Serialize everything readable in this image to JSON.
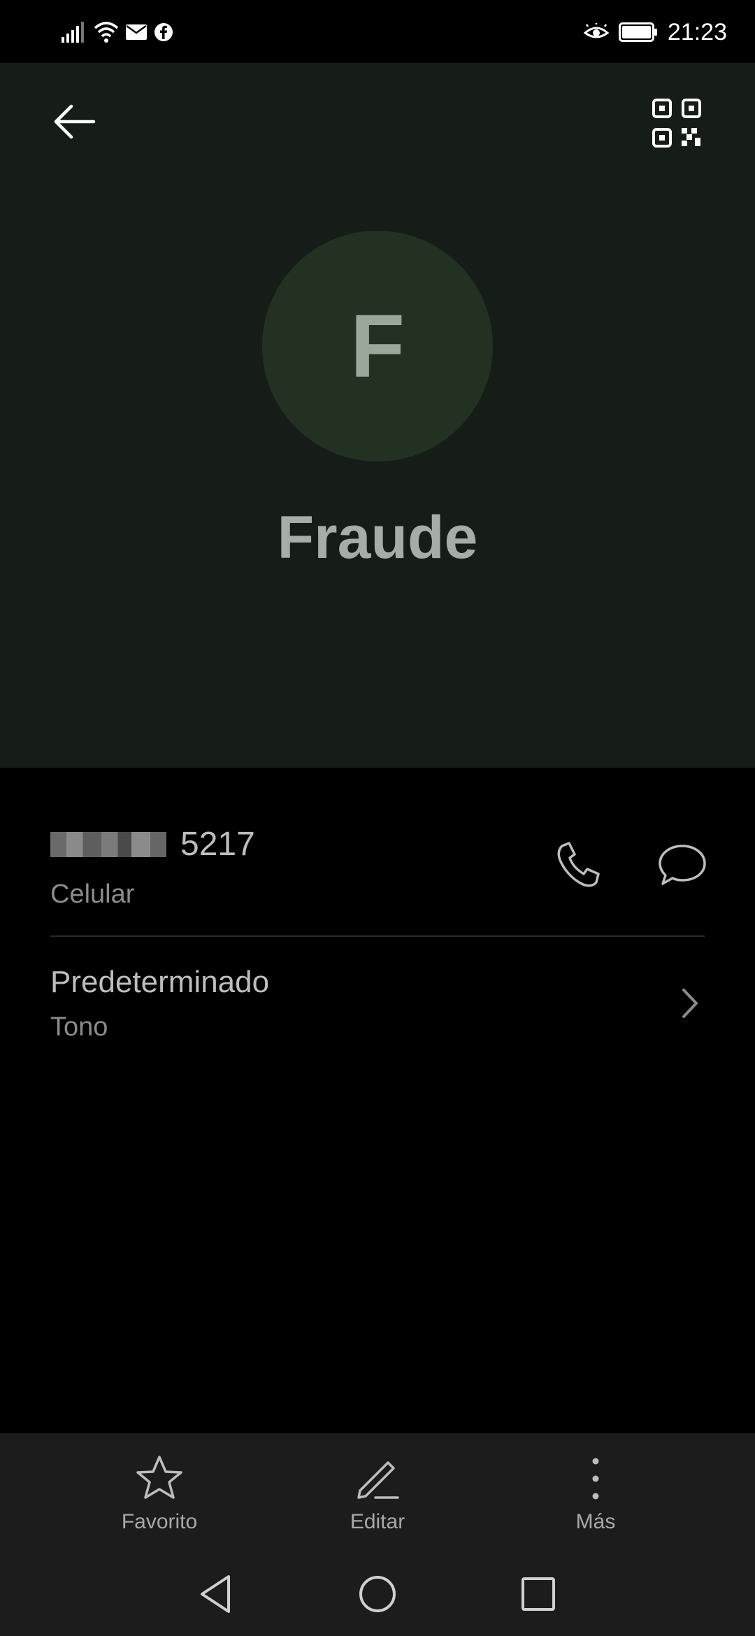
{
  "status_bar": {
    "time": "21:23",
    "icons_left": [
      "signal-icon",
      "wifi-icon",
      "mail-icon",
      "facebook-icon"
    ],
    "icons_right": [
      "eye-comfort-icon",
      "battery-icon"
    ]
  },
  "header": {
    "back_icon": "arrow-left-icon",
    "qr_icon": "qr-code-icon",
    "avatar_letter": "F",
    "contact_name": "Fraude",
    "background_color": "#161d18",
    "avatar_color": "#233123"
  },
  "phone": {
    "number_suffix": "5217",
    "type": "Celular",
    "call_icon": "phone-icon",
    "message_icon": "message-icon"
  },
  "ringtone": {
    "value": "Predeterminado",
    "label": "Tono"
  },
  "bottom_actions": [
    {
      "label": "Favorito",
      "icon": "star-icon"
    },
    {
      "label": "Editar",
      "icon": "pencil-icon"
    },
    {
      "label": "Más",
      "icon": "more-vertical-icon"
    }
  ],
  "system_nav": [
    "back-triangle-icon",
    "home-circle-icon",
    "recents-square-icon"
  ]
}
